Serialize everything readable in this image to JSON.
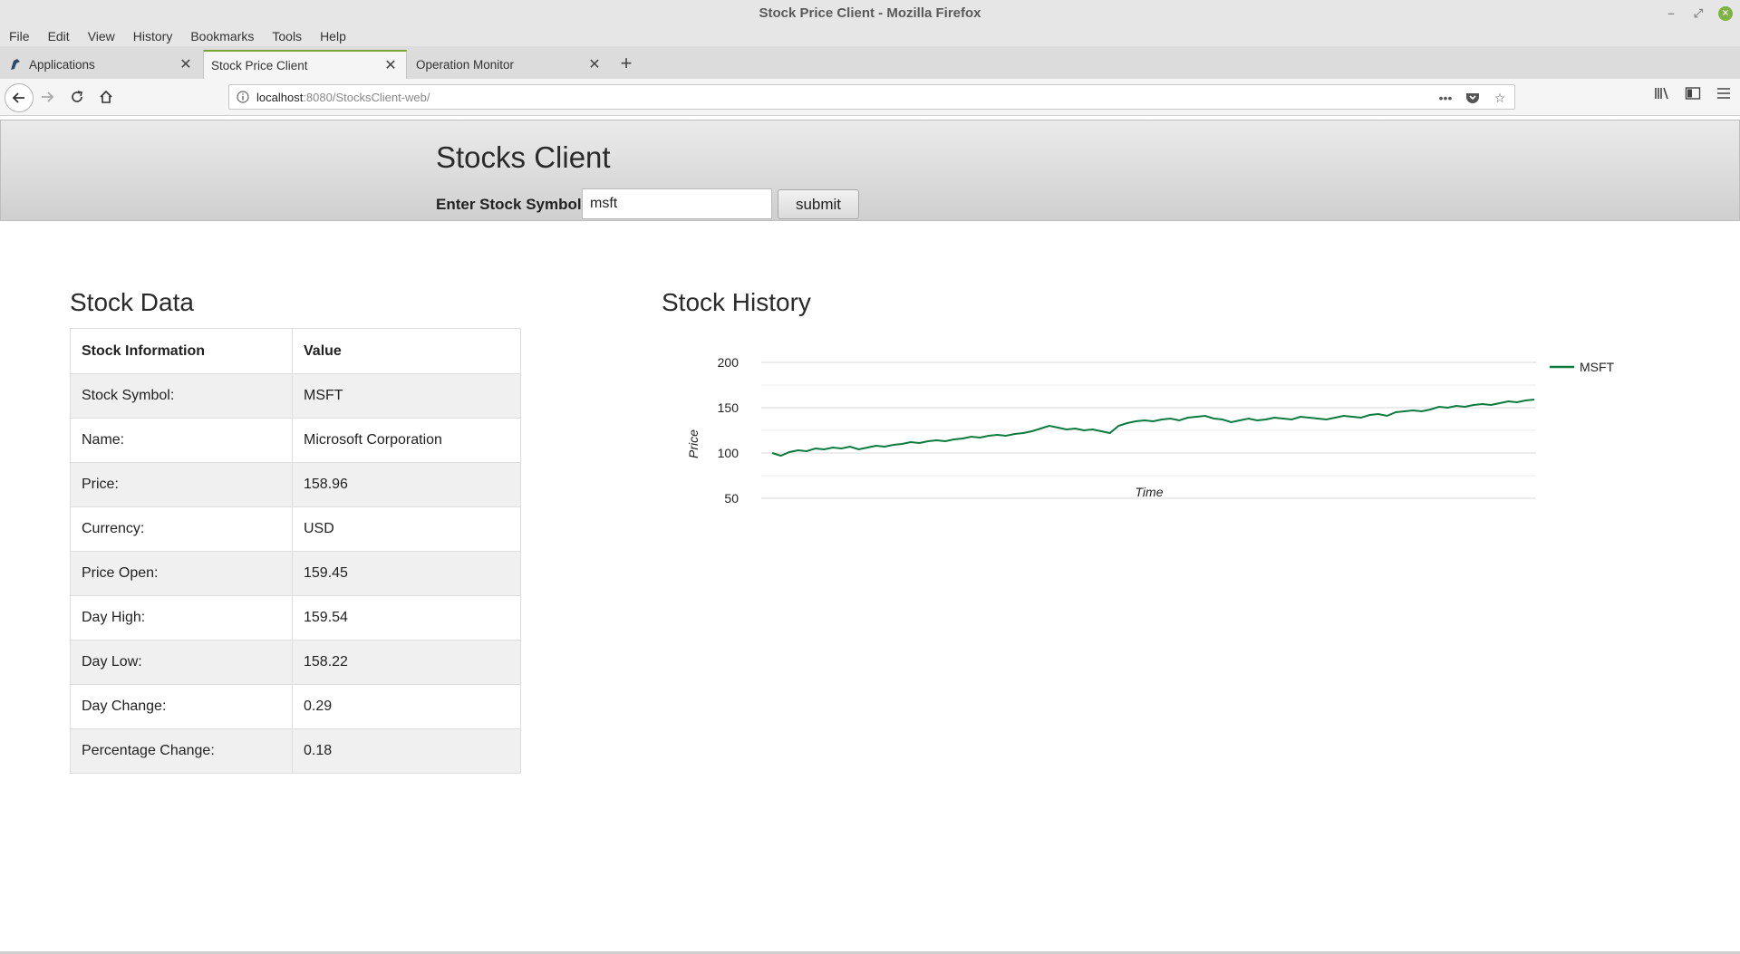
{
  "window": {
    "title": "Stock Price Client - Mozilla Firefox"
  },
  "menu": [
    "File",
    "Edit",
    "View",
    "History",
    "Bookmarks",
    "Tools",
    "Help"
  ],
  "tabs": [
    {
      "label": "Applications",
      "active": false
    },
    {
      "label": "Stock Price Client",
      "active": true
    },
    {
      "label": "Operation Monitor",
      "active": false
    }
  ],
  "urlbar": {
    "host": "localhost",
    "rest": ":8080/StocksClient-web/"
  },
  "page": {
    "title": "Stocks Client",
    "symbol_label": "Enter Stock Symbol:",
    "symbol_value": "msft",
    "submit_label": "submit",
    "data_title": "Stock Data",
    "history_title": "Stock History"
  },
  "table": {
    "headers": [
      "Stock Information",
      "Value"
    ],
    "rows": [
      [
        "Stock Symbol:",
        "MSFT"
      ],
      [
        "Name:",
        "Microsoft Corporation"
      ],
      [
        "Price:",
        "158.96"
      ],
      [
        "Currency:",
        "USD"
      ],
      [
        "Price Open:",
        "159.45"
      ],
      [
        "Day High:",
        "159.54"
      ],
      [
        "Day Low:",
        "158.22"
      ],
      [
        "Day Change:",
        "0.29"
      ],
      [
        "Percentage Change:",
        "0.18"
      ]
    ]
  },
  "chart_data": {
    "type": "line",
    "xlabel": "Time",
    "ylabel": "Price",
    "ylim": [
      50,
      200
    ],
    "yticks": [
      50,
      100,
      150,
      200
    ],
    "legend_position": "right",
    "series": [
      {
        "name": "MSFT",
        "color": "#0b7a3e",
        "values": [
          100,
          97,
          101,
          103,
          102,
          105,
          104,
          106,
          105,
          107,
          104,
          106,
          108,
          107,
          109,
          110,
          112,
          111,
          113,
          114,
          113,
          115,
          116,
          118,
          117,
          119,
          120,
          119,
          121,
          122,
          124,
          127,
          130,
          128,
          126,
          127,
          125,
          126,
          124,
          122,
          130,
          133,
          135,
          136,
          135,
          137,
          138,
          136,
          139,
          140,
          141,
          138,
          137,
          134,
          136,
          138,
          136,
          137,
          139,
          138,
          137,
          140,
          139,
          138,
          137,
          139,
          141,
          140,
          139,
          142,
          143,
          141,
          145,
          146,
          147,
          146,
          148,
          151,
          150,
          152,
          151,
          153,
          154,
          153,
          155,
          157,
          156,
          158,
          159
        ]
      }
    ]
  }
}
